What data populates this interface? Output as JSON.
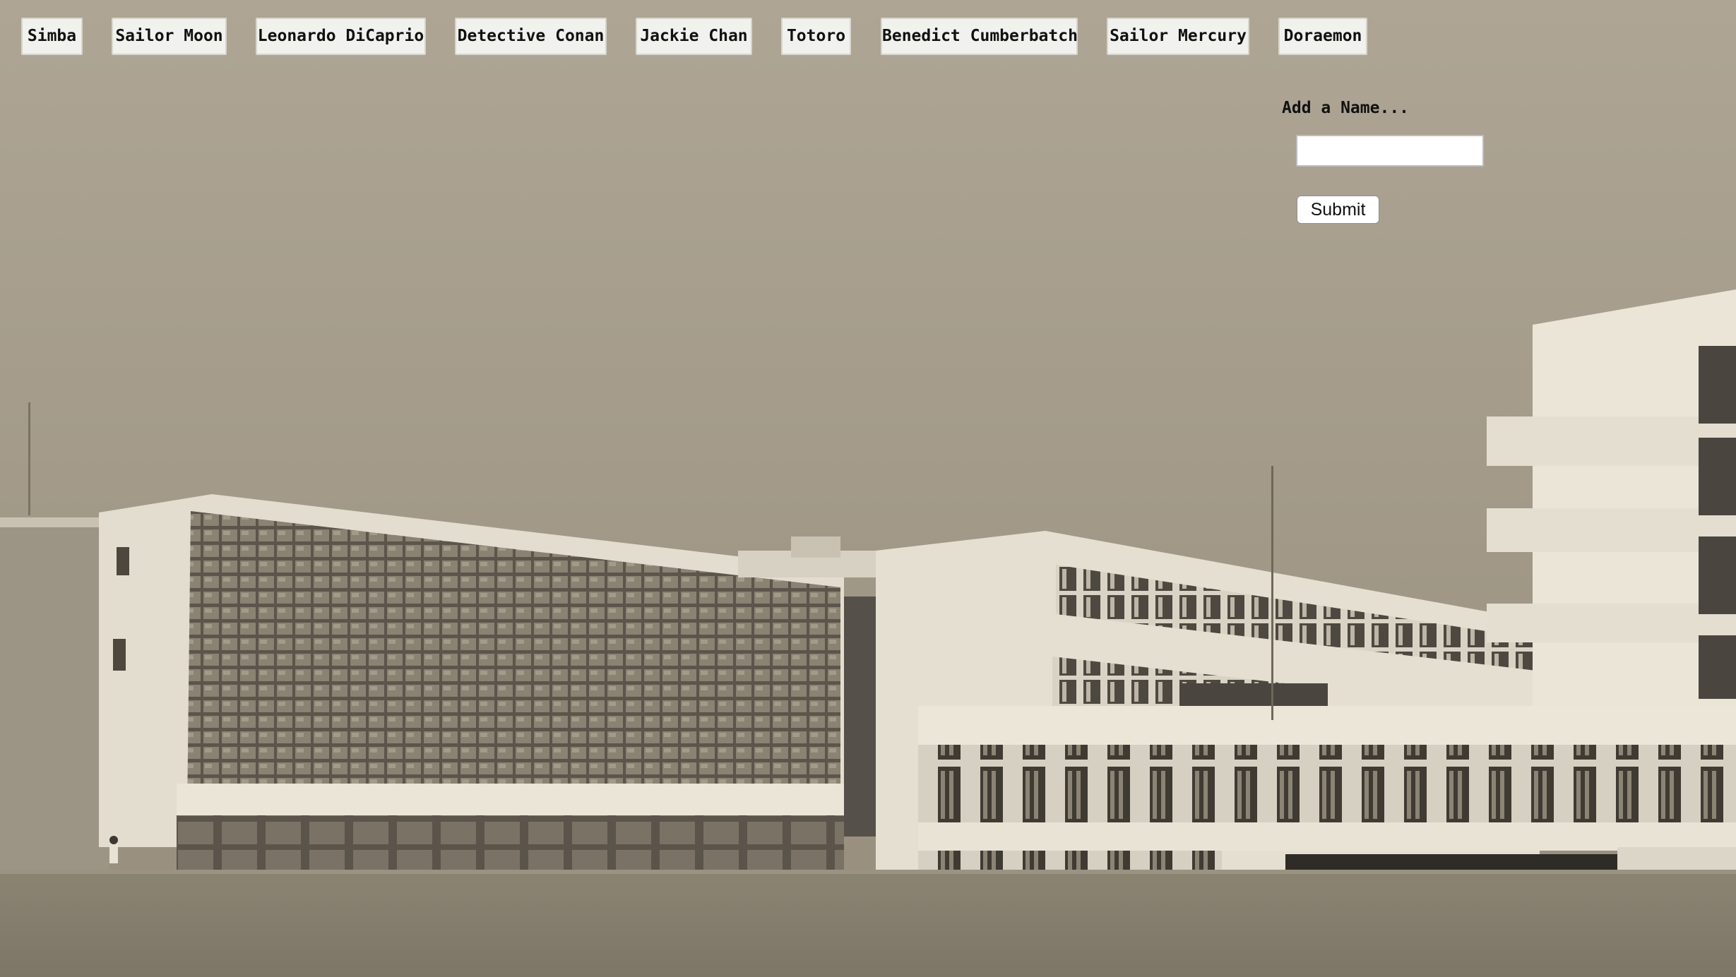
{
  "names": [
    {
      "label": "Simba"
    },
    {
      "label": "Sailor Moon"
    },
    {
      "label": "Leonardo DiCaprio"
    },
    {
      "label": "Detective Conan"
    },
    {
      "label": "Jackie Chan"
    },
    {
      "label": "Totoro"
    },
    {
      "label": "Benedict Cumberbatch"
    },
    {
      "label": "Sailor Mercury"
    },
    {
      "label": "Doraemon"
    }
  ],
  "form": {
    "label": "Add a Name...",
    "input_value": "",
    "submit_label": "Submit"
  },
  "colors": {
    "chip_background": "#f1f1ee",
    "chip_border": "#d8d5cc",
    "sky": "#a59c8b",
    "building": "#ddd7ca",
    "ground": "#8a8274"
  },
  "background": {
    "icon": "sepia-photo-modernist-building"
  }
}
